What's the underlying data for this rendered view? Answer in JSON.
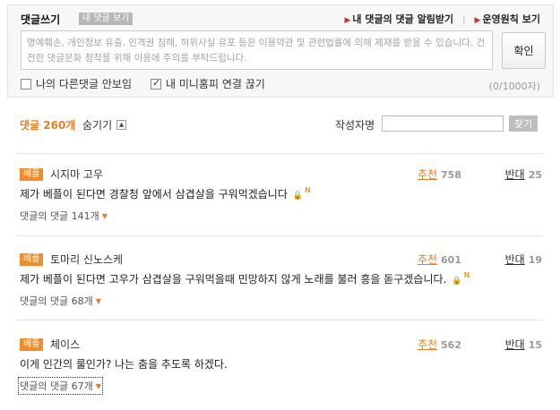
{
  "write": {
    "title": "댓글쓰기",
    "my_comments_tab": "내 댓글 보기",
    "link_alert": "내 댓글의 댓글 알림받기",
    "link_policy": "운영원칙 보기",
    "placeholder": "명예훼손, 개인정보 유출, 인격권 침해, 허위사실 유포 등은 이용약관 및 관련법률에 의해 제재를 받을 수 있습니다. 건전한 댓글문화 정착을 위해 이용에 주의를 부탁드립니다.",
    "submit_label": "확인",
    "option_hide": "나의 다른댓글 안보임",
    "option_hide_checked": false,
    "option_minihompy": "내 미니홈피 연결 끊기",
    "option_minihompy_checked": true,
    "char_count": "(0/1000자)"
  },
  "toolbar": {
    "count_label": "댓글 260개",
    "hide_label": "숨기기",
    "author_search_label": "작성자명",
    "find_label": "찾기"
  },
  "comments": [
    {
      "badge": "베플",
      "author": "시지마 고우",
      "recommend_label": "추천",
      "recommend_count": "758",
      "oppose_label": "반대",
      "oppose_count": "25",
      "text": "제가 베플이 된다면 경찰청 앞에서 삼겹살을 구워먹겠습니다",
      "replies": "댓글의 댓글 141개"
    },
    {
      "badge": "베플",
      "author": "토마리 신노스케",
      "recommend_label": "추천",
      "recommend_count": "601",
      "oppose_label": "반대",
      "oppose_count": "19",
      "text": "제가 베플이 된다면 고우가 삼겹살을 구워먹을때 민망하지 않게 노래를 불러 흥을 돋구겠습니다.",
      "replies": "댓글의 댓글 68개"
    },
    {
      "badge": "베플",
      "author": "체이스",
      "recommend_label": "추천",
      "recommend_count": "562",
      "oppose_label": "반대",
      "oppose_count": "15",
      "text": "이게 인간의 룰인가? 나는 춤을 추도록 하겠다.",
      "replies": "댓글의 댓글 67개"
    }
  ],
  "icons": {
    "lock": "lock-icon",
    "new": "new-icon",
    "caret": "caret-down-icon"
  },
  "colors": {
    "accent": "#e67e22",
    "badge": "#f08c2a"
  }
}
